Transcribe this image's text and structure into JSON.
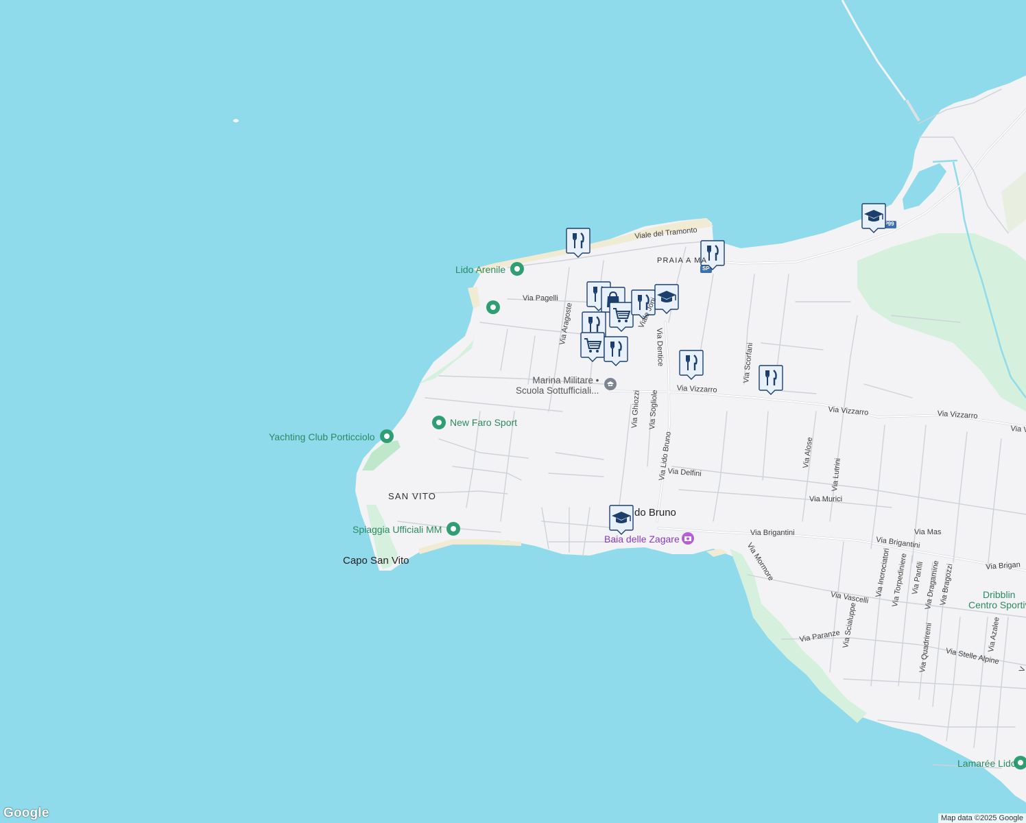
{
  "map": {
    "colors": {
      "water": "#8fdbec",
      "land": "#f3f3f5",
      "park": "#d5f1dd",
      "beach": "#f2ebd3",
      "road": "#ffffff",
      "road_outline": "#c9cdd4",
      "marker_fill": "#e8f0fb",
      "marker_border": "#1d3f6d",
      "pin_green": "#2f9e75"
    },
    "areas": [
      {
        "id": "praia",
        "text": "PRAIA A MA"
      },
      {
        "id": "sanvito",
        "text": "SAN VITO"
      }
    ],
    "places": [
      {
        "id": "capo",
        "text": "Capo San Vito"
      },
      {
        "id": "lidobruno",
        "text": "do Bruno"
      }
    ],
    "pois": [
      {
        "id": "lidoarenile",
        "text": "Lido Arenile",
        "icon": "pin-green"
      },
      {
        "id": "newfaro",
        "text": "New Faro Sport",
        "icon": "pin-green"
      },
      {
        "id": "yachting",
        "text": "Yachting Club Porticciolo",
        "icon": "pin-green"
      },
      {
        "id": "spiaggia",
        "text": "Spiaggia Ufficiali MM",
        "icon": "pin-green"
      },
      {
        "id": "dribbling",
        "text": "Dribblin\nCentro Sportiv",
        "icon": "pin-green"
      },
      {
        "id": "lamaree",
        "text": "Lamarée Lido",
        "icon": "pin-green"
      },
      {
        "id": "marina",
        "text": "Marina Militare •\nScuola Sottufficiali...",
        "icon": "school-icon"
      },
      {
        "id": "baia",
        "text": "Baia delle Zagare",
        "icon": "camera-icon"
      }
    ],
    "streets": [
      {
        "id": "tramonto",
        "text": "Viale del Tramonto"
      },
      {
        "id": "pagelli",
        "text": "Via Pagelli"
      },
      {
        "id": "aragoste",
        "text": "Via Aragoste"
      },
      {
        "id": "joni",
        "text": "Viale Joni"
      },
      {
        "id": "dentice",
        "text": "Via Dentice"
      },
      {
        "id": "vizzarro1",
        "text": "Via Vizzarro"
      },
      {
        "id": "vizzarro2",
        "text": "Via Vizzarro"
      },
      {
        "id": "vizzarro3",
        "text": "Via Vizzarro"
      },
      {
        "id": "vizzarro4",
        "text": "Via V"
      },
      {
        "id": "scorfani",
        "text": "Via Scorfani"
      },
      {
        "id": "ghiozzi",
        "text": "Via Ghiozzi"
      },
      {
        "id": "sogliole",
        "text": "Via Sogliole"
      },
      {
        "id": "lidobrunost",
        "text": "Via Lido Bruno"
      },
      {
        "id": "delfini",
        "text": "Via Delfini"
      },
      {
        "id": "alose",
        "text": "Via Alose"
      },
      {
        "id": "lutrini",
        "text": "Via Lutrini"
      },
      {
        "id": "murici",
        "text": "Via Murici"
      },
      {
        "id": "brigantini1",
        "text": "Via Brigantini"
      },
      {
        "id": "brigantini2",
        "text": "Via Brigantini"
      },
      {
        "id": "brigantini3",
        "text": "Via Brigan"
      },
      {
        "id": "mas",
        "text": "Via Mas"
      },
      {
        "id": "mormore",
        "text": "Via Mormore"
      },
      {
        "id": "vascelli",
        "text": "Via Vascelli"
      },
      {
        "id": "incrociatori",
        "text": "Via Incrociatori"
      },
      {
        "id": "torpediniere",
        "text": "Via Torpediniere"
      },
      {
        "id": "panfili",
        "text": "Via Panfili"
      },
      {
        "id": "dragamine",
        "text": "Via Dragamine"
      },
      {
        "id": "bragozzi",
        "text": "Via Bragozzi"
      },
      {
        "id": "paranze",
        "text": "Via Paranze"
      },
      {
        "id": "scialuppe",
        "text": "Via Scialuppe"
      },
      {
        "id": "quadriremi",
        "text": "Via Quadriremi"
      },
      {
        "id": "azalee",
        "text": "Via Azalee"
      },
      {
        "id": "stellealpine",
        "text": "Via Stelle Alpine"
      },
      {
        "id": "edge",
        "text": "V"
      }
    ],
    "shields": [
      {
        "id": "sp99",
        "text": "SP99"
      },
      {
        "id": "sp2",
        "text": "SP"
      }
    ],
    "markers": [
      {
        "icon": "restaurant-icon"
      },
      {
        "icon": "restaurant-icon"
      },
      {
        "icon": "restaurant-icon"
      },
      {
        "icon": "shopping-bag-icon"
      },
      {
        "icon": "cart-icon"
      },
      {
        "icon": "restaurant-icon"
      },
      {
        "icon": "school-icon"
      },
      {
        "icon": "restaurant-icon"
      },
      {
        "icon": "cart-icon"
      },
      {
        "icon": "restaurant-icon"
      },
      {
        "icon": "restaurant-icon"
      },
      {
        "icon": "restaurant-icon"
      },
      {
        "icon": "school-icon"
      },
      {
        "icon": "school-icon"
      }
    ],
    "attribution": "Map data ©2025 Google",
    "logo": "Google"
  }
}
